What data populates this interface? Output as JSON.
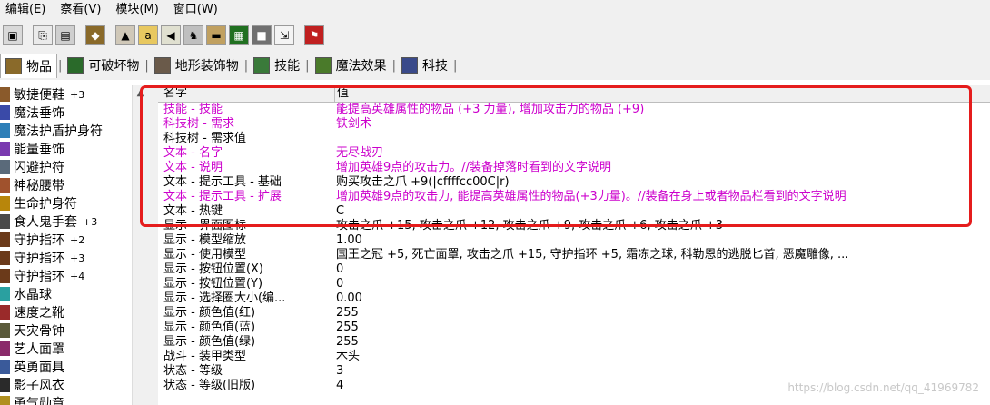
{
  "menu": [
    "编辑(E)",
    "察看(V)",
    "模块(M)",
    "窗口(W)"
  ],
  "toolbar_icons": [
    "save-icon",
    "copy-icon",
    "paste-icon",
    "unit-icon",
    "terrain-icon",
    "text-icon",
    "sound-icon",
    "object-icon",
    "camera-icon",
    "minimap-icon",
    "cube-icon",
    "import-icon",
    "flag-icon"
  ],
  "tabs": [
    {
      "label": "物品",
      "active": true,
      "icon": "item-icon"
    },
    {
      "label": "可破坏物",
      "active": false,
      "icon": "tree-icon"
    },
    {
      "label": "地形装饰物",
      "active": false,
      "icon": "doodad-icon"
    },
    {
      "label": "技能",
      "active": false,
      "icon": "ability-icon"
    },
    {
      "label": "魔法效果",
      "active": false,
      "icon": "buff-icon"
    },
    {
      "label": "科技",
      "active": false,
      "icon": "upgrade-icon"
    }
  ],
  "items": [
    {
      "name": "敏捷便鞋",
      "badge": "+3",
      "color": "#8a5a2b"
    },
    {
      "name": "魔法垂饰",
      "badge": "",
      "color": "#3a4aa8"
    },
    {
      "name": "魔法护盾护身符",
      "badge": "",
      "color": "#2e7fb8"
    },
    {
      "name": "能量垂饰",
      "badge": "",
      "color": "#7a3ab0"
    },
    {
      "name": "闪避护符",
      "badge": "",
      "color": "#5a6a7a"
    },
    {
      "name": "神秘腰带",
      "badge": "",
      "color": "#a0522d"
    },
    {
      "name": "生命护身符",
      "badge": "",
      "color": "#b8860b"
    },
    {
      "name": "食人鬼手套",
      "badge": "+3",
      "color": "#4a4a4a"
    },
    {
      "name": "守护指环",
      "badge": "+2",
      "color": "#6b3a1a"
    },
    {
      "name": "守护指环",
      "badge": "+3",
      "color": "#6b3a1a"
    },
    {
      "name": "守护指环",
      "badge": "+4",
      "color": "#6b3a1a"
    },
    {
      "name": "水晶球",
      "badge": "",
      "color": "#2aa0a0"
    },
    {
      "name": "速度之靴",
      "badge": "",
      "color": "#9a2a2a"
    },
    {
      "name": "天灾骨钟",
      "badge": "",
      "color": "#5a5a3a"
    },
    {
      "name": "艺人面罩",
      "badge": "",
      "color": "#8a2a6a"
    },
    {
      "name": "英勇面具",
      "badge": "",
      "color": "#3a5a9a"
    },
    {
      "name": "影子风衣",
      "badge": "",
      "color": "#2a2a2a"
    },
    {
      "name": "勇气勋章",
      "badge": "",
      "color": "#b09020"
    }
  ],
  "grid": {
    "col_name": "名字",
    "col_value": "值",
    "rows": [
      {
        "name": "技能 - 技能",
        "value": "能提高英雄属性的物品 (+3 力量), 增加攻击力的物品 (+9)",
        "pink": true
      },
      {
        "name": "科技树 - 需求",
        "value": "铁剑术",
        "pink": true
      },
      {
        "name": "科技树 - 需求值",
        "value": "",
        "pink": false
      },
      {
        "name": "文本 - 名字",
        "value": "无尽战刃",
        "pink": true
      },
      {
        "name": "文本 - 说明",
        "value": "增加英雄9点的攻击力。//装备掉落时看到的文字说明",
        "pink": true
      },
      {
        "name": "文本 - 提示工具 - 基础",
        "value": "购买攻击之爪 +9(|cffffcc00C|r)",
        "pink": false
      },
      {
        "name": "文本 - 提示工具 - 扩展",
        "value": "增加英雄9点的攻击力, 能提高英雄属性的物品(+3力量)。//装备在身上或者物品栏看到的文字说明",
        "pink": true
      },
      {
        "name": "文本 - 热键",
        "value": "C",
        "pink": false
      },
      {
        "name": "显示 - 界面图标",
        "value": "攻击之爪 +15, 攻击之爪 +12, 攻击之爪 +9, 攻击之爪 +6, 攻击之爪 +3",
        "pink": false
      },
      {
        "name": "显示 - 模型缩放",
        "value": "1.00",
        "pink": false
      },
      {
        "name": "显示 - 使用模型",
        "value": "国王之冠 +5, 死亡面罩, 攻击之爪 +15, 守护指环 +5, 霜冻之球, 科勒恩的逃脱匕首, 恶魔雕像, ...",
        "pink": false
      },
      {
        "name": "显示 - 按钮位置(X)",
        "value": "0",
        "pink": false
      },
      {
        "name": "显示 - 按钮位置(Y)",
        "value": "0",
        "pink": false
      },
      {
        "name": "显示 - 选择圈大小(编...",
        "value": "0.00",
        "pink": false
      },
      {
        "name": "显示 - 颜色值(红)",
        "value": "255",
        "pink": false
      },
      {
        "name": "显示 - 颜色值(蓝)",
        "value": "255",
        "pink": false
      },
      {
        "name": "显示 - 颜色值(绿)",
        "value": "255",
        "pink": false
      },
      {
        "name": "战斗 - 装甲类型",
        "value": "木头",
        "pink": false
      },
      {
        "name": "状态 - 等级",
        "value": "3",
        "pink": false
      },
      {
        "name": "状态 - 等级(旧版)",
        "value": "4",
        "pink": false
      }
    ]
  },
  "watermark": "https://blog.csdn.net/qq_41969782",
  "colors": {
    "highlight": "#e51c1c",
    "pink_text": "#cc00cc"
  }
}
